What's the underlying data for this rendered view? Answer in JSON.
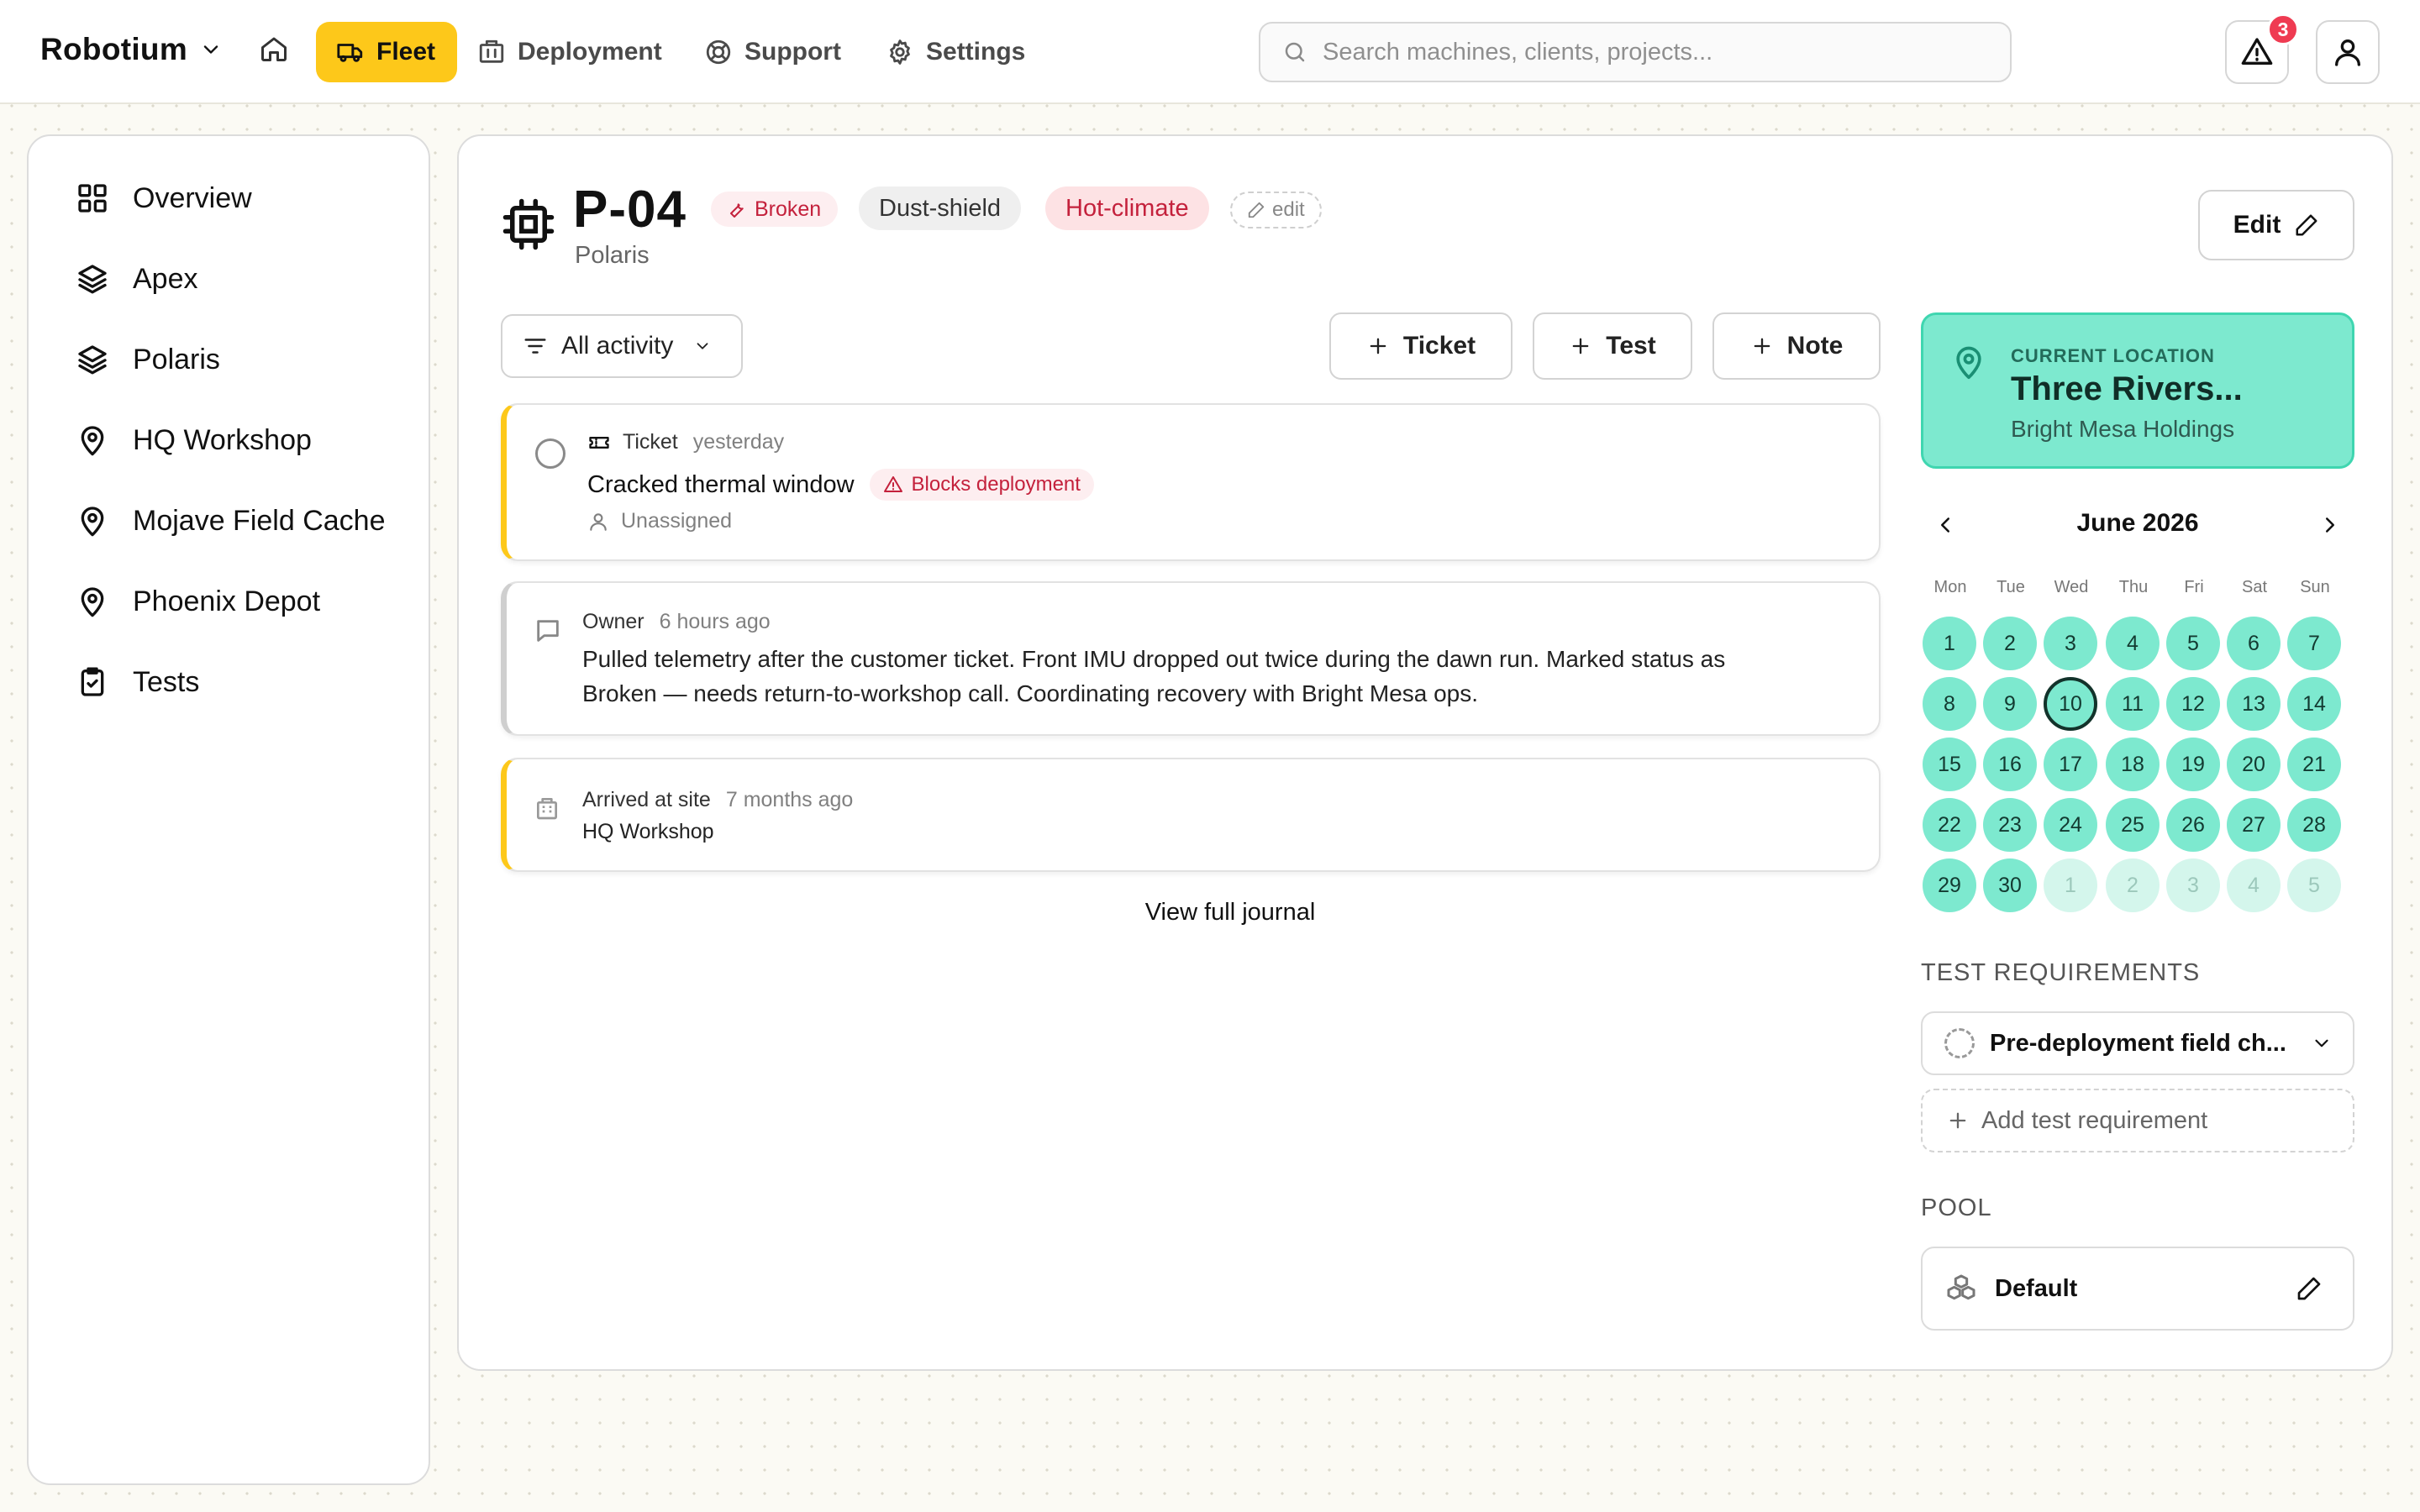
{
  "app": {
    "brand": "Robotium"
  },
  "nav": [
    {
      "label": "Fleet",
      "icon": "truck-icon",
      "active": true
    },
    {
      "label": "Deployment",
      "icon": "building-icon"
    },
    {
      "label": "Support",
      "icon": "lifebuoy-icon"
    },
    {
      "label": "Settings",
      "icon": "gear-icon"
    }
  ],
  "search": {
    "placeholder": "Search machines, clients, projects..."
  },
  "alerts": {
    "count": "3"
  },
  "sidebar": {
    "items": [
      {
        "label": "Overview",
        "icon": "grid-icon"
      },
      {
        "label": "Apex",
        "icon": "layers-icon"
      },
      {
        "label": "Polaris",
        "icon": "layers-icon"
      },
      {
        "label": "HQ Workshop",
        "icon": "map-pin-icon"
      },
      {
        "label": "Mojave Field Cache",
        "icon": "map-pin-icon"
      },
      {
        "label": "Phoenix Depot",
        "icon": "map-pin-icon"
      },
      {
        "label": "Tests",
        "icon": "clipboard-check-icon"
      }
    ]
  },
  "machine": {
    "id": "P-04",
    "project": "Polaris",
    "status": "Broken",
    "tags": [
      "Dust-shield",
      "Hot-climate"
    ],
    "tag_edit": "edit",
    "edit_label": "Edit"
  },
  "activity": {
    "filter": "All activity",
    "buttons": {
      "ticket": "Ticket",
      "test": "Test",
      "note": "Note"
    },
    "entries": [
      {
        "type": "Ticket",
        "time": "yesterday",
        "title": "Cracked thermal window",
        "badge": "Blocks deployment",
        "assignee": "Unassigned"
      },
      {
        "type": "Owner",
        "time": "6 hours ago",
        "text": "Pulled telemetry after the customer ticket. Front IMU dropped out twice during the dawn run. Marked status as Broken — needs return-to-workshop call. Coordinating recovery with Bright Mesa ops."
      },
      {
        "type": "Arrived at site",
        "time": "7 months ago",
        "place": "HQ Workshop"
      }
    ],
    "view_journal": "View full journal"
  },
  "location": {
    "label": "CURRENT LOCATION",
    "name": "Three Rivers...",
    "client": "Bright Mesa Holdings"
  },
  "calendar": {
    "month": "June 2026",
    "weekdays": [
      "Mon",
      "Tue",
      "Wed",
      "Thu",
      "Fri",
      "Sat",
      "Sun"
    ],
    "days": [
      "1",
      "2",
      "3",
      "4",
      "5",
      "6",
      "7",
      "8",
      "9",
      "10",
      "11",
      "12",
      "13",
      "14",
      "15",
      "16",
      "17",
      "18",
      "19",
      "20",
      "21",
      "22",
      "23",
      "24",
      "25",
      "26",
      "27",
      "28",
      "29",
      "30"
    ],
    "next_month_days": [
      "1",
      "2",
      "3",
      "4",
      "5"
    ],
    "today": "10"
  },
  "test_requirements": {
    "label": "TEST REQUIREMENTS",
    "selected": "Pre-deployment field ch...",
    "add_label": "Add test requirement"
  },
  "pool": {
    "label": "POOL",
    "value": "Default"
  },
  "colors": {
    "accent": "#fdc81a",
    "mint": "#7de9cf",
    "danger": "#c4213c"
  }
}
